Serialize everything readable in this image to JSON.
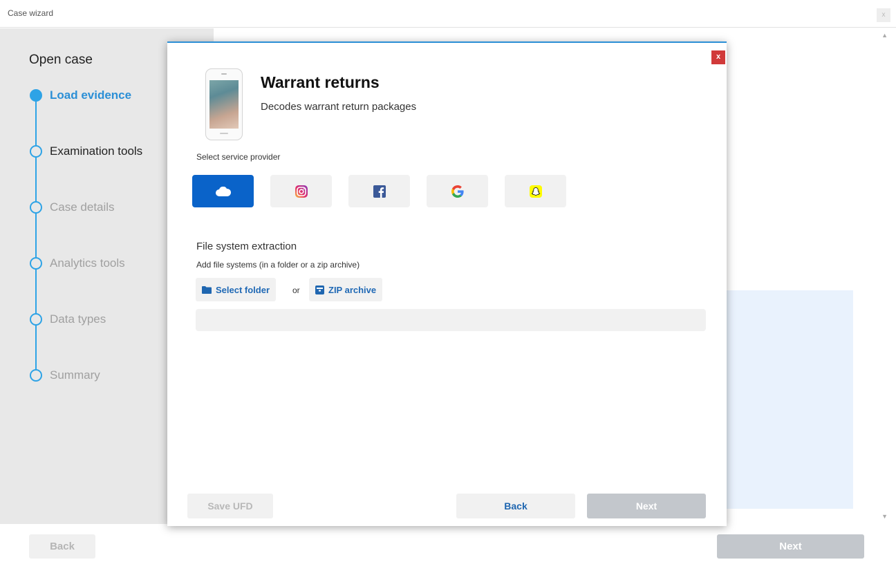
{
  "window": {
    "title": "Case wizard",
    "close_label": "x"
  },
  "sidebar": {
    "heading": "Open case",
    "steps": [
      {
        "label": "Load evidence",
        "state": "active"
      },
      {
        "label": "Examination tools",
        "state": "current"
      },
      {
        "label": "Case details",
        "state": "pending"
      },
      {
        "label": "Analytics tools",
        "state": "pending"
      },
      {
        "label": "Data types",
        "state": "pending"
      },
      {
        "label": "Summary",
        "state": "pending"
      }
    ]
  },
  "footer": {
    "back_label": "Back",
    "next_label": "Next"
  },
  "modal": {
    "close_label": "x",
    "title": "Warrant returns",
    "subtitle": "Decodes warrant return packages",
    "select_provider_label": "Select service provider",
    "providers": [
      {
        "name": "cloud",
        "icon": "cloud-icon",
        "selected": true
      },
      {
        "name": "instagram",
        "icon": "instagram-icon",
        "selected": false
      },
      {
        "name": "facebook",
        "icon": "facebook-icon",
        "selected": false
      },
      {
        "name": "google",
        "icon": "google-icon",
        "selected": false
      },
      {
        "name": "snapchat",
        "icon": "snapchat-icon",
        "selected": false
      }
    ],
    "fs_title": "File system extraction",
    "fs_subtitle": "Add file systems (in a folder or a zip archive)",
    "select_folder_label": "Select folder",
    "or_label": "or",
    "zip_archive_label": "ZIP archive",
    "path_value": "",
    "save_ufd_label": "Save UFD",
    "back_label": "Back",
    "next_label": "Next"
  },
  "colors": {
    "accent": "#2ea3e6",
    "selected_provider": "#0a63c9",
    "close_red": "#d13a3a",
    "link_blue": "#1f66b0",
    "disabled_next": "#c3c7cc"
  }
}
